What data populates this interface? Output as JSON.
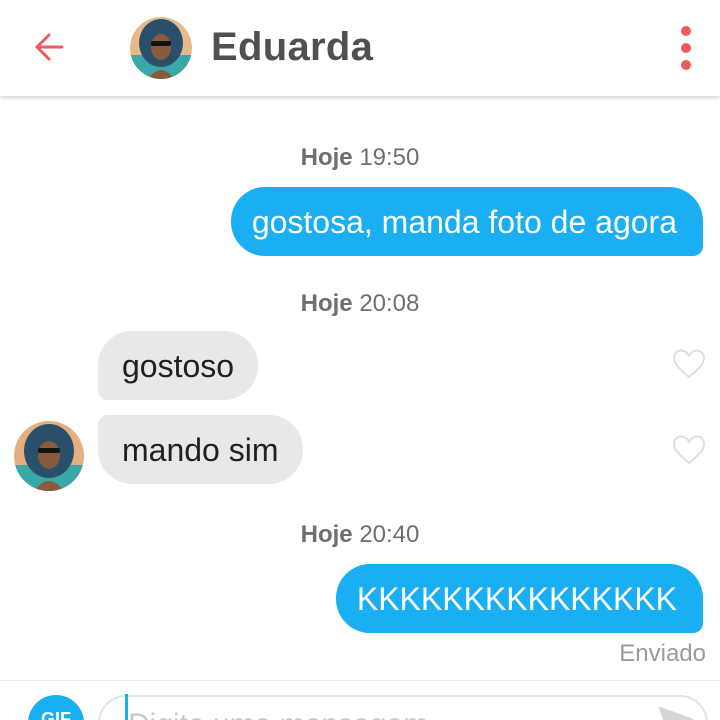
{
  "header": {
    "name": "Eduarda",
    "accent_color": "#ee5a5f"
  },
  "conversation": {
    "groups": [
      {
        "day": "Hoje",
        "time": "19:50"
      },
      {
        "day": "Hoje",
        "time": "20:08"
      },
      {
        "day": "Hoje",
        "time": "20:40"
      }
    ],
    "messages": [
      {
        "direction": "sent",
        "text": "gostosa, manda foto de agora"
      },
      {
        "direction": "received",
        "text": "gostoso"
      },
      {
        "direction": "received",
        "text": "mando sim"
      },
      {
        "direction": "sent",
        "text": "KKKKKKKKKKKKKKK"
      }
    ],
    "last_status": "Enviado"
  },
  "composer": {
    "gif_label": "GIF",
    "placeholder": "Digite uma mensagem"
  },
  "colors": {
    "sent_bubble": "#1aaef2",
    "received_bubble": "#e8e8e8",
    "timestamp_text": "#6f6f6f"
  }
}
